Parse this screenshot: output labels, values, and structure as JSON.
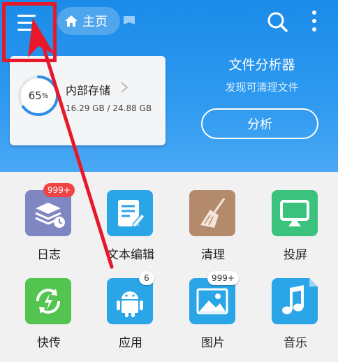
{
  "header": {
    "breadcrumb_home": "主页",
    "icons": [
      "menu-icon",
      "home-icon",
      "tag-icon",
      "search-icon",
      "more-vert-icon"
    ]
  },
  "storage": {
    "percent": "65",
    "percent_unit": "%",
    "title": "内部存储",
    "size": "16.29 GB / 24.88 GB",
    "used_fraction": 0.65
  },
  "analyzer": {
    "title": "文件分析器",
    "subtitle": "发现可清理文件",
    "button": "分析"
  },
  "tiles": [
    {
      "label": "日志",
      "icon": "log-icon",
      "badge": "999+",
      "color": "#7f86c2"
    },
    {
      "label": "文本编辑",
      "icon": "text-edit-icon",
      "badge": "",
      "color": "#2aa6e8"
    },
    {
      "label": "清理",
      "icon": "broom-icon",
      "badge": "",
      "color": "#b48a6d"
    },
    {
      "label": "投屏",
      "icon": "cast-icon",
      "badge": "",
      "color": "#3bc27d"
    },
    {
      "label": "快传",
      "icon": "quick-transfer-icon",
      "badge": "",
      "color": "#52c44f"
    },
    {
      "label": "应用",
      "icon": "android-icon",
      "badge": "6",
      "color": "#2aa6e8"
    },
    {
      "label": "图片",
      "icon": "image-icon",
      "badge": "999+",
      "color": "#2aa6e8"
    },
    {
      "label": "音乐",
      "icon": "music-icon",
      "badge": "",
      "color": "#2aa6e8"
    }
  ],
  "colors": {
    "header_blue": "#1a8be8",
    "annotation_red": "#e8182a"
  }
}
